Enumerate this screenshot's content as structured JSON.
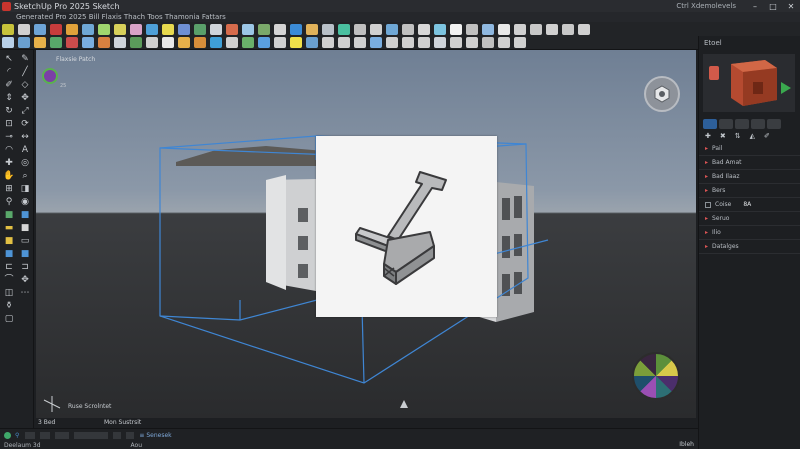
{
  "window": {
    "title": "SketchUp Pro 2025 Sketch",
    "title_extra": "Ctrl Xdemolevels",
    "minimize_label": "–",
    "maximize_label": "□",
    "close_label": "✕"
  },
  "menubar": {
    "items_text": "Generated Pro 2025 Bill Flaxis Thach Toos Thamonia Fattars"
  },
  "toolbar": {
    "row1_icons": [
      "select-icon",
      "eraser-icon",
      "paint-bucket-icon",
      "line-icon",
      "arc-icon",
      "shape-icon",
      "push-pull-icon",
      "move-icon",
      "rotate-icon",
      "scale-icon",
      "offset-icon",
      "tape-icon",
      "dimension-icon",
      "protractor-icon",
      "text-icon",
      "axes-icon",
      "3d-text-icon",
      "orbit-icon",
      "pan-icon",
      "zoom-icon",
      "zoom-extents-icon",
      "section-plane-icon",
      "warehouse-icon",
      "extension-icon",
      "layer-icon",
      "style-icon",
      "scene-icon",
      "shadow-icon",
      "fog-icon",
      "match-photo-icon",
      "components-icon",
      "materials-icon",
      "outliner-icon",
      "entity-info-icon",
      "instructor-icon",
      "solid-tools-icon",
      "sandbox-icon"
    ],
    "row1_colors": [
      "#c7c23a",
      "#d0d0d0",
      "#6ea5d7",
      "#c83c3c",
      "#e0a23a",
      "#6fa8d6",
      "#9fd66e",
      "#d7d05a",
      "#d9a3c8",
      "#4ea0d8",
      "#e7d94e",
      "#6e8fd3",
      "#5aa06a",
      "#cfd4da",
      "#d66b4c",
      "#9bc6e6",
      "#7aa96a",
      "#d4d4d4",
      "#3b8bd6",
      "#e0b25a",
      "#b8c0c8",
      "#4ac0a0",
      "#c0c0c0",
      "#d0d0d0",
      "#6fa8d6",
      "#c0c0c0",
      "#d8d8d8",
      "#7cc4e0",
      "#f2f2f2",
      "#c0c0c0",
      "#8fb8e0",
      "#e8e8e8",
      "#d0d0d0",
      "#c8c8c8",
      "#d0d0d0",
      "#c8c8c8",
      "#d0d0d0"
    ],
    "row2_icons": [
      "select-icon",
      "rectangle-icon",
      "circle-icon",
      "polygon-icon",
      "freehand-icon",
      "follow-me-icon",
      "intersect-icon",
      "group-icon",
      "component-icon",
      "hide-icon",
      "lock-icon",
      "unlock-icon",
      "flip-icon",
      "soften-icon",
      "smooth-icon",
      "texture-icon",
      "camera-icon",
      "walk-icon",
      "look-icon",
      "position-icon",
      "standard-views-icon",
      "iso-icon",
      "top-icon",
      "front-icon",
      "right-icon",
      "back-icon",
      "left-icon",
      "xray-icon",
      "wireframe-icon",
      "hidden-line-icon",
      "shaded-icon",
      "textured-icon",
      "monochrome-icon"
    ],
    "row2_colors": [
      "#b8d0e8",
      "#6aa0d0",
      "#e6b04a",
      "#58a86a",
      "#cc4c4c",
      "#7aaee0",
      "#d88040",
      "#cfd4da",
      "#5b9b5b",
      "#d0d0d0",
      "#e8e8e8",
      "#e6b04a",
      "#d88e3a",
      "#3f9fd6",
      "#d0d0d0",
      "#6ab06a",
      "#5aa0e0",
      "#d0d0d0",
      "#f0e04a",
      "#6aa0d0",
      "#d0d0d0",
      "#d0d0d0",
      "#d0d0d0",
      "#7aaee0",
      "#d0d0d0",
      "#d0d0d0",
      "#d0d0d0",
      "#cfd4da",
      "#d0d0d0",
      "#d0d0d0",
      "#c0c0c0",
      "#d0d0d0",
      "#d0d0d0"
    ]
  },
  "left_toolbar": {
    "icons": [
      {
        "name": "select-tool-icon",
        "glyph": "↖",
        "color": "#c7cbd0"
      },
      {
        "name": "paint-tool-icon",
        "glyph": "✎",
        "color": "#c7cbd0"
      },
      {
        "name": "arc-tool-icon",
        "glyph": "◜",
        "color": "#c7cbd0"
      },
      {
        "name": "line-tool-icon",
        "glyph": "╱",
        "color": "#c7cbd0"
      },
      {
        "name": "pencil-tool-icon",
        "glyph": "✐",
        "color": "#c7cbd0"
      },
      {
        "name": "eraser-tool-icon",
        "glyph": "◇",
        "color": "#c7cbd0"
      },
      {
        "name": "pushpull-tool-icon",
        "glyph": "⇕",
        "color": "#c7cbd0"
      },
      {
        "name": "move-tool-icon",
        "glyph": "✥",
        "color": "#c7cbd0"
      },
      {
        "name": "rotate-tool-icon",
        "glyph": "↻",
        "color": "#c7cbd0"
      },
      {
        "name": "scale-tool-icon",
        "glyph": "⤢",
        "color": "#c7cbd0"
      },
      {
        "name": "offset-tool-icon",
        "glyph": "⊡",
        "color": "#c7cbd0"
      },
      {
        "name": "followme-tool-icon",
        "glyph": "⟳",
        "color": "#c7cbd0"
      },
      {
        "name": "tape-tool-icon",
        "glyph": "⊸",
        "color": "#c7cbd0"
      },
      {
        "name": "dimension-tool-icon",
        "glyph": "↔",
        "color": "#c7cbd0"
      },
      {
        "name": "protractor-tool-icon",
        "glyph": "◠",
        "color": "#c7cbd0"
      },
      {
        "name": "text-tool-icon",
        "glyph": "A",
        "color": "#c7cbd0"
      },
      {
        "name": "axes-tool-icon",
        "glyph": "✚",
        "color": "#c7cbd0"
      },
      {
        "name": "orbit-tool-icon",
        "glyph": "◎",
        "color": "#c7cbd0"
      },
      {
        "name": "pan-tool-icon",
        "glyph": "✋",
        "color": "#c7cbd0"
      },
      {
        "name": "zoom-tool-icon",
        "glyph": "⌕",
        "color": "#c7cbd0"
      },
      {
        "name": "zoom-window-icon",
        "glyph": "⊞",
        "color": "#c7cbd0"
      },
      {
        "name": "section-tool-icon",
        "glyph": "◨",
        "color": "#c7cbd0"
      },
      {
        "name": "walk-tool-icon",
        "glyph": "⚲",
        "color": "#c7cbd0"
      },
      {
        "name": "look-tool-icon",
        "glyph": "◉",
        "color": "#c7cbd0"
      },
      {
        "name": "component-tool-icon",
        "glyph": "■",
        "color": "#59a86a"
      },
      {
        "name": "warehouse-tool-icon",
        "glyph": "■",
        "color": "#4e94d6"
      },
      {
        "name": "layer-tool-icon",
        "glyph": "▬",
        "color": "#e2c044"
      },
      {
        "name": "style-tool-icon",
        "glyph": "■",
        "color": "#d6d6d6"
      },
      {
        "name": "scene-tool-icon",
        "glyph": "■",
        "color": "#e2c044"
      },
      {
        "name": "fog-tool-icon",
        "glyph": "▭",
        "color": "#c7cbd0"
      },
      {
        "name": "material-tool-icon",
        "glyph": "■",
        "color": "#4e94d6"
      },
      {
        "name": "image-tool-icon",
        "glyph": "■",
        "color": "#4e94d6"
      },
      {
        "name": "measure-tool-icon",
        "glyph": "⊏",
        "color": "#c7cbd0"
      },
      {
        "name": "cut-tool-icon",
        "glyph": "⊐",
        "color": "#c7cbd0"
      },
      {
        "name": "plane-tool-icon",
        "glyph": "⌒",
        "color": "#c7cbd0"
      },
      {
        "name": "solid-tool-icon",
        "glyph": "✥",
        "color": "#c7cbd0"
      },
      {
        "name": "inspector-tool-icon",
        "glyph": "◫",
        "color": "#c7cbd0"
      },
      {
        "name": "outliner-tool-icon",
        "glyph": "⋯",
        "color": "#c7cbd0"
      },
      {
        "name": "dropper-tool-icon",
        "glyph": "⚱",
        "color": "#c7cbd0"
      },
      {
        "name": "blank-tool-icon",
        "glyph": "",
        "color": "#c7cbd0"
      },
      {
        "name": "document-tool-icon",
        "glyph": "▢",
        "color": "#c7cbd0"
      }
    ]
  },
  "viewport": {
    "scene_label": "Flaxsie Patch",
    "axis_label": "25",
    "bottom_label": "Ruse Scrolntet"
  },
  "tray": {
    "header": "Etoel",
    "sections": [
      {
        "label": "Pail"
      },
      {
        "label": "Bad Amat"
      },
      {
        "label": "Bad Ilaaz"
      },
      {
        "label": "Bers"
      },
      {
        "label": "Coise",
        "value": "8A"
      },
      {
        "label": "Seruo"
      },
      {
        "label": "Ilio"
      },
      {
        "label": "Datalges"
      }
    ]
  },
  "statusbar": {
    "row1_left": "3 Bed",
    "row1_mid": "Mon Sustrsit",
    "row2_left": "Deelaum   3d",
    "row2_mid": "Aou",
    "row2_blue": "≡ Senesek",
    "right_text": "Ibleh"
  }
}
